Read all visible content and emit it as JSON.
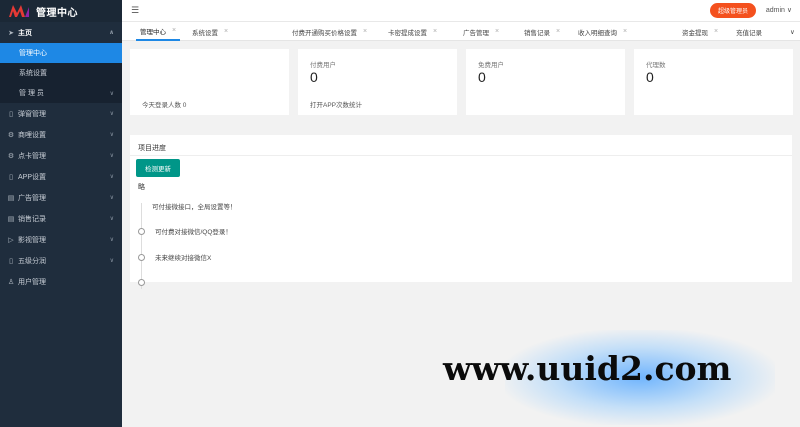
{
  "brand": {
    "title": "管理中心",
    "accent": "#e53935"
  },
  "sidebar": {
    "items": [
      {
        "label": "主页",
        "icon": "send-icon",
        "arrow": "up"
      },
      {
        "label": "管理中心",
        "sub": true,
        "active": true
      },
      {
        "label": "系统设置",
        "sub": true
      },
      {
        "label": "管 理 员",
        "sub": true,
        "arrow": "down"
      },
      {
        "label": "弹窗管理",
        "icon": "phone-icon",
        "arrow": "down"
      },
      {
        "label": "商哩设置",
        "icon": "gear-icon",
        "arrow": "down"
      },
      {
        "label": "点卡管理",
        "icon": "gear-icon",
        "arrow": "down"
      },
      {
        "label": "APP设置",
        "icon": "phone-icon",
        "arrow": "down"
      },
      {
        "label": "广告管理",
        "icon": "note-icon",
        "arrow": "down"
      },
      {
        "label": "销售记录",
        "icon": "note-icon",
        "arrow": "down"
      },
      {
        "label": "影视管理",
        "icon": "play-icon",
        "arrow": "down"
      },
      {
        "label": "五级分润",
        "icon": "phone-icon",
        "arrow": "down"
      },
      {
        "label": "用户管理",
        "icon": "user-icon"
      }
    ]
  },
  "header": {
    "menu_toggle": "☰",
    "admin_button": "超级管理员",
    "user": "admin ∨"
  },
  "tabs": [
    {
      "label": "管理中心",
      "closable": true,
      "active": true
    },
    {
      "label": "系统设置",
      "closable": true
    },
    {
      "label": "付费开通购买价格设置",
      "closable": true
    },
    {
      "label": "卡密提成设置",
      "closable": true
    },
    {
      "label": "广告管理",
      "closable": true
    },
    {
      "label": "销售记录",
      "closable": true
    },
    {
      "label": "收入明细查询",
      "closable": true
    },
    {
      "label": "资金提现",
      "closable": true
    },
    {
      "label": "充值记录",
      "closable": false
    }
  ],
  "tab_more": "∨",
  "stats": [
    {
      "label": "",
      "value": "",
      "footer": "今天登录人数  0"
    },
    {
      "label": "付费用户",
      "value": "0",
      "footer": "打开APP次数统计"
    },
    {
      "label": "免费用户",
      "value": "0",
      "footer": ""
    },
    {
      "label": "代理数",
      "value": "0",
      "footer": ""
    }
  ],
  "progress": {
    "title": "项目进度",
    "check_button": "检测更新",
    "timeline_head": "略",
    "items": [
      {
        "text": "可付接微接口，全局设置等！"
      },
      {
        "text": "可付费对接微信/QQ登录！"
      },
      {
        "text": "未来继续对接微信X"
      },
      {
        "text": ""
      }
    ]
  },
  "watermark": "www.uuid2.com"
}
